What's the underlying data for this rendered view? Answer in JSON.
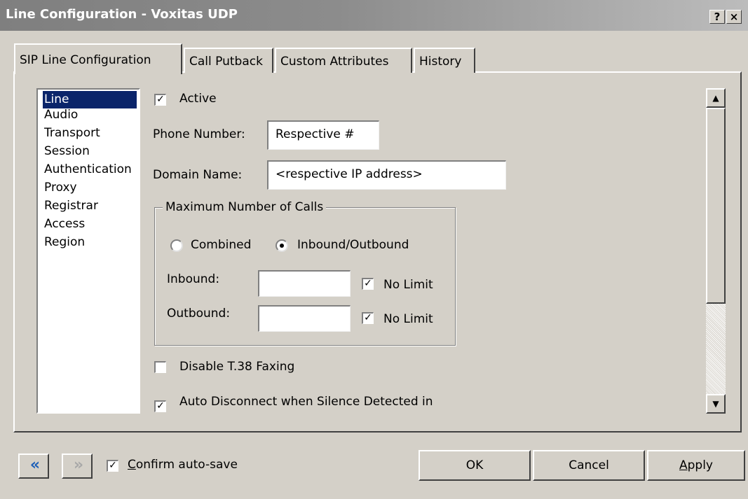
{
  "window": {
    "title": "Line Configuration - Voxitas UDP",
    "help_glyph": "?",
    "close_glyph": "×"
  },
  "tabs": [
    {
      "label": "SIP Line Configuration",
      "active": true
    },
    {
      "label": "Call Putback",
      "active": false
    },
    {
      "label": "Custom Attributes",
      "active": false
    },
    {
      "label": "History",
      "active": false
    }
  ],
  "sidebar": {
    "items": [
      {
        "label": "Line",
        "selected": true
      },
      {
        "label": "Audio"
      },
      {
        "label": "Transport"
      },
      {
        "label": "Session"
      },
      {
        "label": "Authentication"
      },
      {
        "label": "Proxy"
      },
      {
        "label": "Registrar"
      },
      {
        "label": "Access"
      },
      {
        "label": "Region"
      }
    ]
  },
  "form": {
    "active": {
      "label": "Active",
      "checked": true
    },
    "phone_number": {
      "label": "Phone Number:",
      "value": "Respective #"
    },
    "domain_name": {
      "label": "Domain Name:",
      "value": "<respective IP address>"
    },
    "max_calls": {
      "title": "Maximum Number of Calls",
      "combined": {
        "label": "Combined",
        "selected": false
      },
      "inbound_outbound": {
        "label": "Inbound/Outbound",
        "selected": true
      },
      "inbound": {
        "label": "Inbound:",
        "value": "",
        "no_limit_label": "No Limit",
        "no_limit_checked": true
      },
      "outbound": {
        "label": "Outbound:",
        "value": "",
        "no_limit_label": "No Limit",
        "no_limit_checked": true
      }
    },
    "disable_t38": {
      "label": "Disable T.38 Faxing",
      "checked": false
    },
    "auto_disconnect": {
      "label": "Auto Disconnect when Silence Detected in",
      "checked": true
    }
  },
  "footer": {
    "confirm_autosave": {
      "label_accel": "C",
      "label_rest": "onfirm auto-save",
      "checked": true
    },
    "ok_label": "OK",
    "cancel_label": "Cancel",
    "apply_accel": "A",
    "apply_rest": "pply"
  },
  "icons": {
    "check": "✓",
    "up": "▲",
    "down": "▼",
    "back": "«",
    "forward": "»"
  },
  "colors": {
    "selection": "#0a246a",
    "face": "#d4d0c8",
    "nav_active": "#1c5fb8"
  }
}
